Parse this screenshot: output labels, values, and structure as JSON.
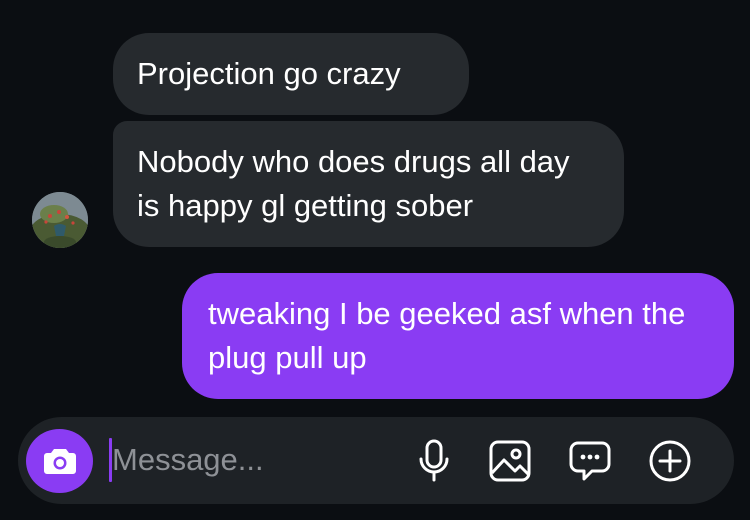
{
  "messages": [
    {
      "direction": "incoming",
      "text": "Projection go crazy"
    },
    {
      "direction": "incoming",
      "text": "Nobody who does drugs all day is happy gl getting sober"
    },
    {
      "direction": "outgoing",
      "text": "tweaking I be geeked asf when the plug pull up"
    }
  ],
  "composer": {
    "placeholder": "Message...",
    "icons": [
      "camera-icon",
      "microphone-icon",
      "image-icon",
      "sticker-chat-icon",
      "plus-circle-icon"
    ]
  },
  "colors": {
    "background": "#0b0e12",
    "incoming_bubble": "#262a2e",
    "outgoing_bubble": "#8a3cf3",
    "composer_bg": "#1e2226",
    "accent": "#8a3cf3",
    "placeholder": "#8e9196"
  }
}
